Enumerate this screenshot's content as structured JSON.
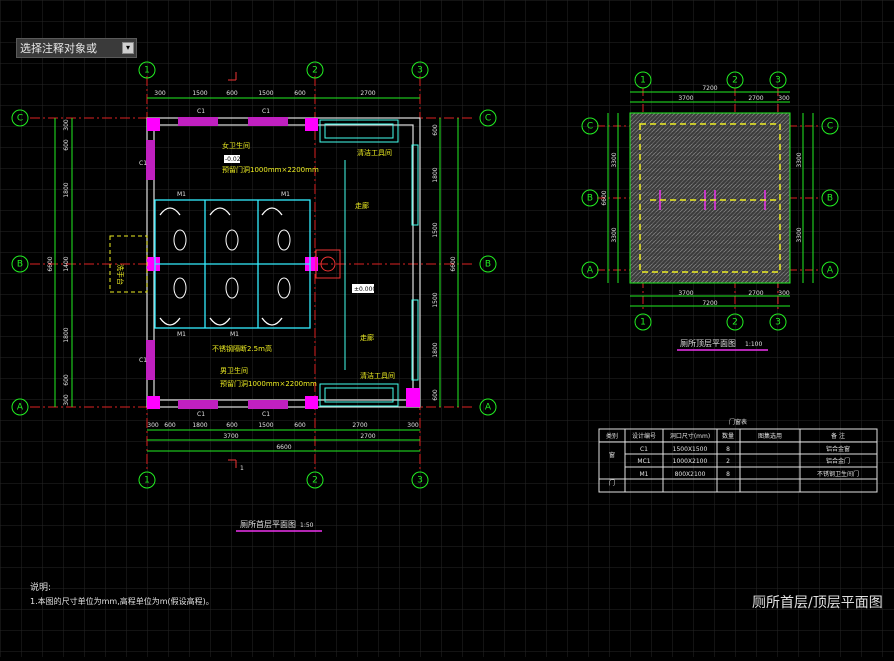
{
  "command_prompt": {
    "text": "选择注释对象或",
    "dropdown_icon": "chevron-down-icon"
  },
  "axis_labels": {
    "A": "A",
    "B": "B",
    "C": "C",
    "n1": "1",
    "n2": "2",
    "n3": "3"
  },
  "plan_left": {
    "title": "厕所首层平面图",
    "scale": "1:50",
    "top_dims": [
      "300",
      "1500",
      "600",
      "1500",
      "600",
      "2700"
    ],
    "bottom_dims": [
      "300",
      "600",
      "1800",
      "600",
      "1500",
      "600",
      "2700",
      "300"
    ],
    "bottom_total_1": "3700",
    "bottom_total_2": "2700",
    "bottom_total": "6600",
    "left_dims": [
      "300",
      "600",
      "1800",
      "1400",
      "1800",
      "600",
      "300"
    ],
    "left_total": "6600",
    "right_dims": [
      "600",
      "1800",
      "1500",
      "1500",
      "1800",
      "600"
    ],
    "window_labels": [
      "C1",
      "C1",
      "C1",
      "C1",
      "C1",
      "C1"
    ],
    "door_labels": [
      "M1",
      "M1",
      "M1",
      "M1"
    ],
    "room_female": "女卫生间",
    "room_male": "男卫生间",
    "note_female": "预留门洞1000mm×2200mm",
    "note_male": "预留门洞1000mm×2200mm",
    "note_partition": "不锈钢隔断2.5m高",
    "corridor_1": "走廊",
    "corridor_2": "走廊",
    "tool_room_1": "清洁工具间",
    "tool_room_2": "清洁工具间",
    "wash_label": "洗手台",
    "level_tag": "±0.000",
    "level_tag_small": "-0.020",
    "section_mark": "1"
  },
  "plan_right": {
    "title": "厕所顶层平面图",
    "scale": "1:100",
    "top_dims": [
      "3700",
      "2700",
      "300"
    ],
    "top_total": "7200",
    "bottom_dims": [
      "3700",
      "2700",
      "300"
    ],
    "bottom_total": "7200",
    "left_dims": [
      "3300",
      "3300"
    ],
    "left_total": "6600",
    "right_dims": [
      "3300",
      "3300"
    ]
  },
  "door_window_table": {
    "title": "门窗表",
    "headers": [
      "类别",
      "设计编号",
      "洞口尺寸(mm)",
      "数量",
      "图集选用",
      "备 注"
    ],
    "rows": [
      {
        "category": "窗",
        "code": "C1",
        "size": "1500X1500",
        "qty": "8",
        "atlas": "",
        "note": "铝合金窗"
      },
      {
        "category": "",
        "code": "MC1",
        "size": "1000X2100",
        "qty": "2",
        "atlas": "",
        "note": "铝合金门"
      },
      {
        "category": "门",
        "code": "M1",
        "size": "800X2100",
        "qty": "8",
        "atlas": "",
        "note": "不锈钢卫生间门"
      }
    ]
  },
  "notes": {
    "heading": "说明:",
    "line1": "1.本图的尺寸单位为mm,高程单位为m(假设高程)。"
  },
  "sheet_title": "厕所首层/顶层平面图"
}
